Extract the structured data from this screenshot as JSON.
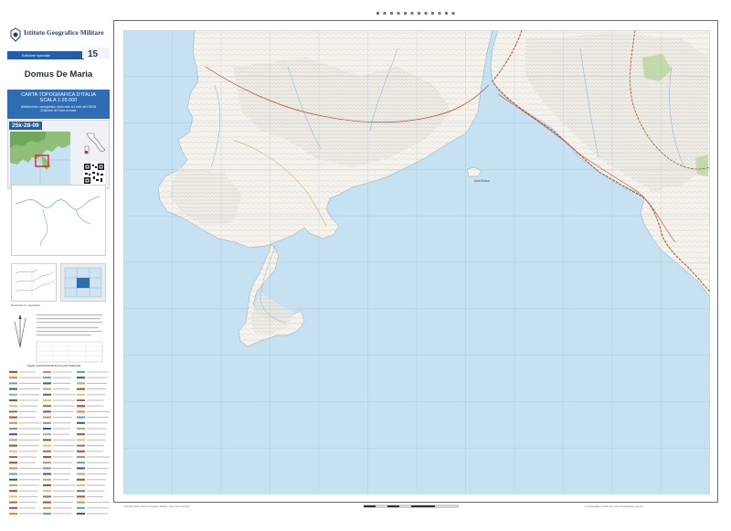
{
  "header": {
    "institute_name": "Istituto Geografico Militare",
    "edition_label": "Edizione speciale",
    "badge_number": "15"
  },
  "sheet": {
    "name": "Domus De Maria",
    "title_line1": "CARTA TOPOGRAFICA D'ITALIA",
    "title_line2": "SCALA 1:25 000",
    "subtitle_line1": "Allestimento cartografico elaborato sui dati del DBSN",
    "subtitle_line2": "Edizione di Forze Armate",
    "code": "25k-28-09"
  },
  "map": {
    "sea_color": "#c5e1f2",
    "land_color": "#f4f3ee",
    "boundary_color": "#a0522d",
    "island_label": "Isola Rossa"
  },
  "marginalia": {
    "declination_caption": "Declinazione magnetica",
    "legend_title": "Segni convenzionali di uso più frequente",
    "footer_left": "Copyright 2021 Istituto Geografico Militare. Tutti i diritti riservati.",
    "footer_right": "La cartografia prodotta non viola la legislazione vigente."
  },
  "colors": {
    "brand_blue": "#1f5ea8",
    "title_blue": "#2e6db3",
    "frame": "#6c6c6c",
    "contour": "#b9a88f",
    "road_red": "#c8423a"
  }
}
